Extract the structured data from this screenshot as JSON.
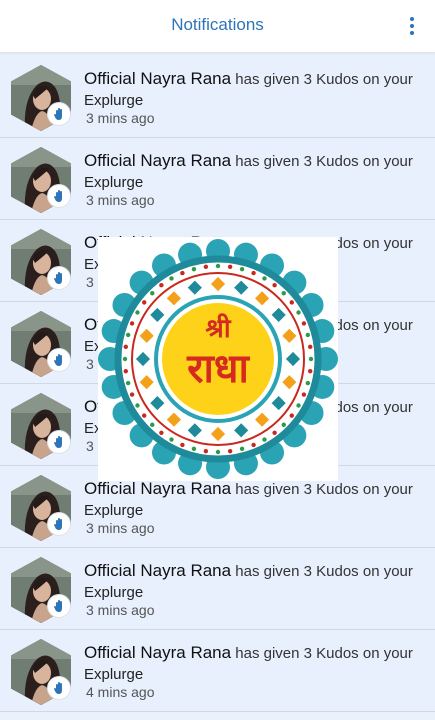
{
  "header": {
    "title": "Notifications",
    "menu_icon": "more-vertical-icon",
    "accent_color": "#2d74b8"
  },
  "notifications": [
    {
      "name": "Official Nayra Rana",
      "action": "has given 3 Kudos on your",
      "object": "Explurge",
      "time": "3 mins ago"
    },
    {
      "name": "Official Nayra Rana",
      "action": "has given 3 Kudos on your",
      "object": "Explurge",
      "time": "3 mins ago"
    },
    {
      "name": "Official Nayra Rana",
      "action": "has given 3 Kudos on your",
      "object": "Explurge",
      "time": "3 mins ago"
    },
    {
      "name": "Official Nayra Rana",
      "action": "has given 3 Kudos on your",
      "object": "Explurge",
      "time": "3 mins ago"
    },
    {
      "name": "Official Nayra Rana",
      "action": "has given 3 Kudos on your",
      "object": "Explurge",
      "time": "3 mins ago"
    },
    {
      "name": "Official Nayra Rana",
      "action": "has given 3 Kudos on your",
      "object": "Explurge",
      "time": "3 mins ago"
    },
    {
      "name": "Official Nayra Rana",
      "action": "has given 3 Kudos on your",
      "object": "Explurge",
      "time": "3 mins ago"
    },
    {
      "name": "Official Nayra Rana",
      "action": "has given 3 Kudos on your",
      "object": "Explurge",
      "time": "4 mins ago"
    }
  ],
  "overlay": {
    "text_top": "श्री",
    "text_main": "राधा",
    "colors": {
      "ring": "#1f8a9a",
      "outer_petals": "#2aa3b5",
      "center": "#ffd21a",
      "text": "#d42a1f",
      "red": "#c8281e",
      "orange": "#f3a11b",
      "green": "#2d9a47"
    }
  }
}
